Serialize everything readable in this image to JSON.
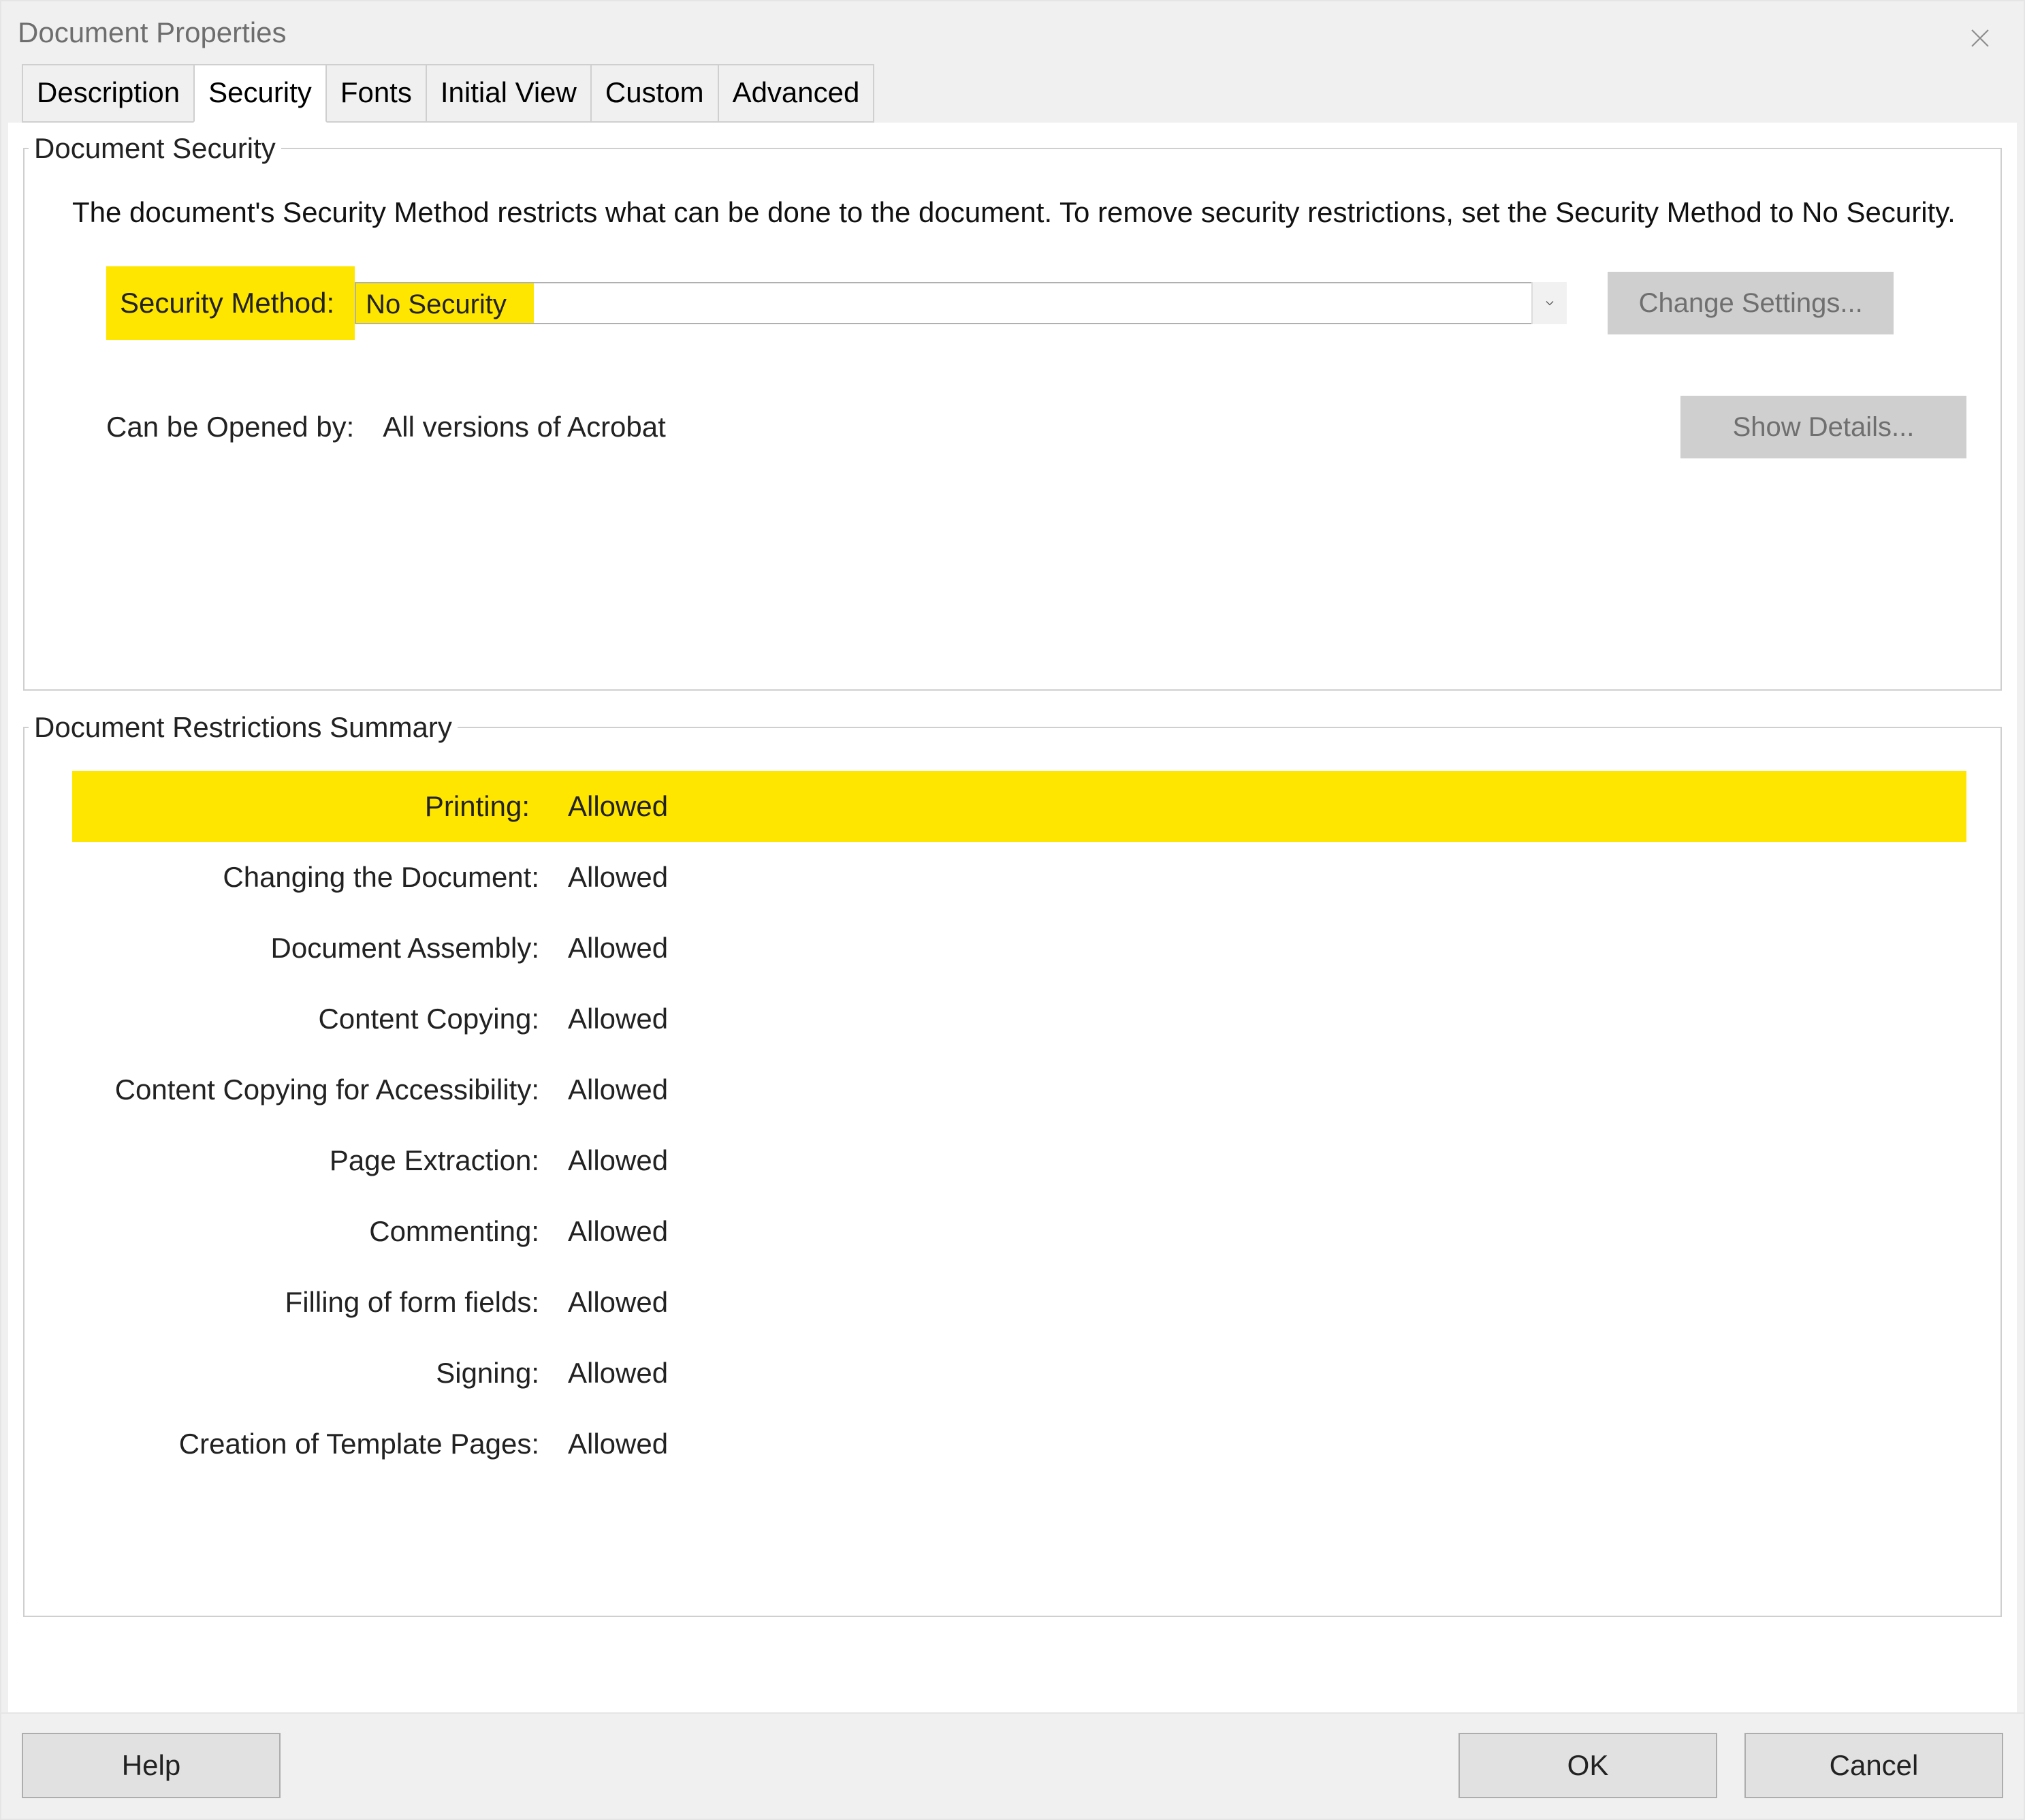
{
  "window": {
    "title": "Document Properties"
  },
  "tabs": [
    "Description",
    "Security",
    "Fonts",
    "Initial View",
    "Custom",
    "Advanced"
  ],
  "active_tab_index": 1,
  "security": {
    "group_title": "Document Security",
    "intro": "The document's Security Method restricts what can be done to the document. To remove security restrictions, set the Security Method to No Security.",
    "method_label": "Security Method:",
    "method_value": "No Security",
    "change_settings": "Change Settings...",
    "opened_by_label": "Can be Opened by:",
    "opened_by_value": "All versions of Acrobat",
    "show_details": "Show Details..."
  },
  "restrictions": {
    "group_title": "Document Restrictions Summary",
    "rows": [
      {
        "label": "Printing:",
        "value": "Allowed",
        "highlight": true
      },
      {
        "label": "Changing the Document:",
        "value": "Allowed"
      },
      {
        "label": "Document Assembly:",
        "value": "Allowed"
      },
      {
        "label": "Content Copying:",
        "value": "Allowed"
      },
      {
        "label": "Content Copying for Accessibility:",
        "value": "Allowed"
      },
      {
        "label": "Page Extraction:",
        "value": "Allowed"
      },
      {
        "label": "Commenting:",
        "value": "Allowed"
      },
      {
        "label": "Filling of form fields:",
        "value": "Allowed"
      },
      {
        "label": "Signing:",
        "value": "Allowed"
      },
      {
        "label": "Creation of Template Pages:",
        "value": "Allowed"
      }
    ]
  },
  "footer": {
    "help": "Help",
    "ok": "OK",
    "cancel": "Cancel"
  }
}
